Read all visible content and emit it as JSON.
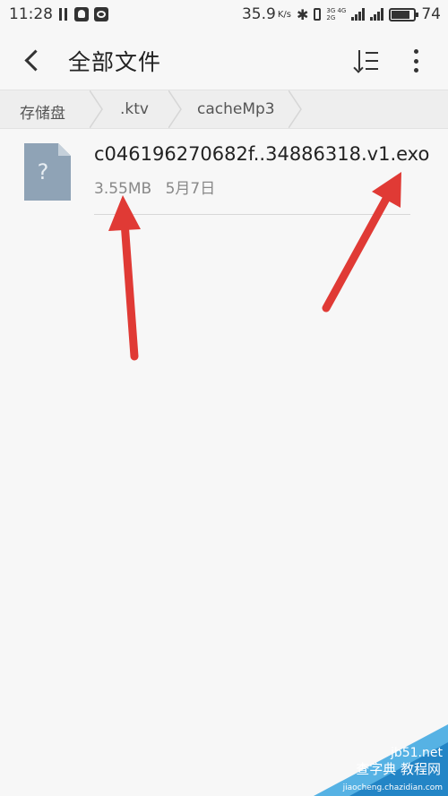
{
  "status_bar": {
    "time": "11:28",
    "speed": "35.9",
    "speed_unit": "K/s",
    "net_top": "3G 4G",
    "net_bottom": "2G",
    "battery": "74"
  },
  "header": {
    "title": "全部文件"
  },
  "breadcrumb": {
    "items": [
      "存储盘",
      ".ktv",
      "cacheMp3"
    ]
  },
  "files": [
    {
      "name": "c046196270682f..34886318.v1.exo",
      "size": "3.55MB",
      "date": "5月7日",
      "icon": "unknown-file-icon"
    }
  ],
  "annotations": {
    "arrow_color": "#e03a35"
  },
  "watermark": {
    "line1": "jb51.net",
    "line2": "查字典 教程网",
    "line3": "jiaocheng.chazidian.com"
  }
}
